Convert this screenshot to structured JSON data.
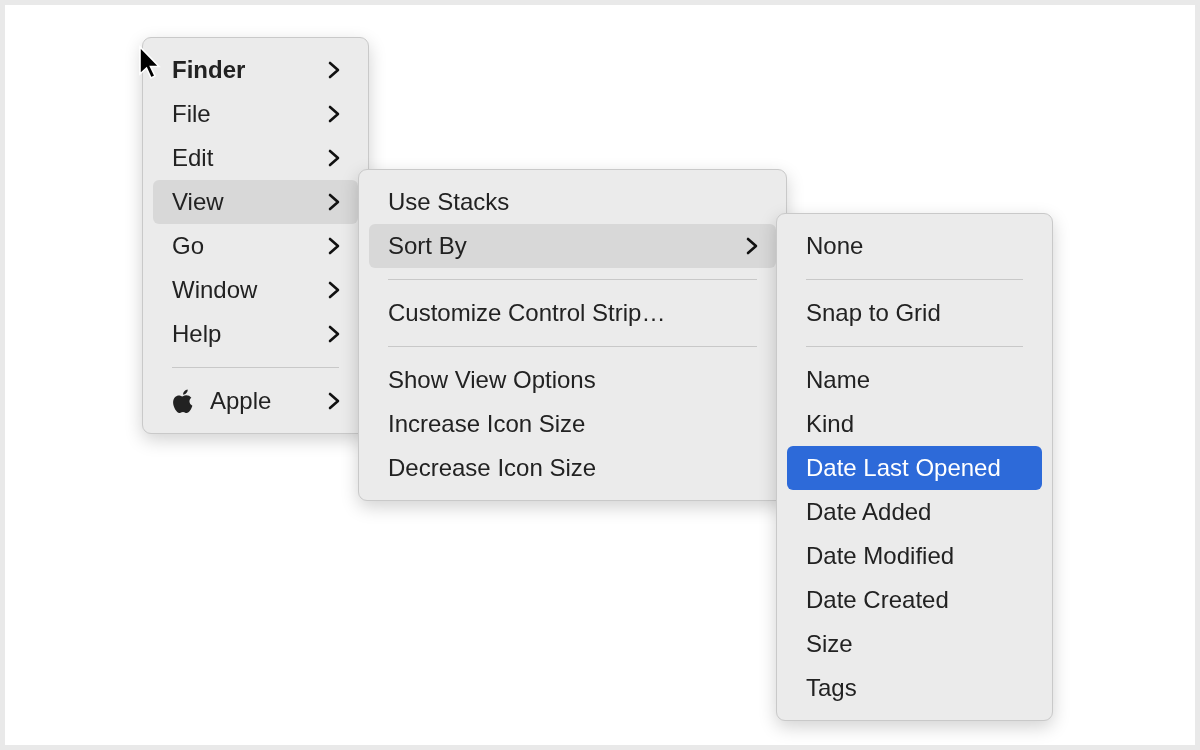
{
  "menus": [
    {
      "items": [
        {
          "kind": "app",
          "label": "Finder",
          "submenu": true,
          "expanded": false,
          "selected": false
        },
        {
          "kind": "item",
          "label": "File",
          "submenu": true,
          "expanded": false,
          "selected": false
        },
        {
          "kind": "item",
          "label": "Edit",
          "submenu": true,
          "expanded": false,
          "selected": false
        },
        {
          "kind": "item",
          "label": "View",
          "submenu": true,
          "expanded": true,
          "selected": false
        },
        {
          "kind": "item",
          "label": "Go",
          "submenu": true,
          "expanded": false,
          "selected": false
        },
        {
          "kind": "item",
          "label": "Window",
          "submenu": true,
          "expanded": false,
          "selected": false
        },
        {
          "kind": "item",
          "label": "Help",
          "submenu": true,
          "expanded": false,
          "selected": false
        },
        {
          "kind": "separator"
        },
        {
          "kind": "logo",
          "label": "Apple",
          "submenu": true,
          "expanded": false,
          "selected": false
        }
      ]
    },
    {
      "items": [
        {
          "kind": "item",
          "label": "Use Stacks",
          "submenu": false,
          "expanded": false,
          "selected": false
        },
        {
          "kind": "item",
          "label": "Sort By",
          "submenu": true,
          "expanded": true,
          "selected": false
        },
        {
          "kind": "separator"
        },
        {
          "kind": "item",
          "label": "Customize Control Strip…",
          "submenu": false,
          "expanded": false,
          "selected": false
        },
        {
          "kind": "separator"
        },
        {
          "kind": "item",
          "label": "Show View Options",
          "submenu": false,
          "expanded": false,
          "selected": false
        },
        {
          "kind": "item",
          "label": "Increase Icon Size",
          "submenu": false,
          "expanded": false,
          "selected": false
        },
        {
          "kind": "item",
          "label": "Decrease Icon Size",
          "submenu": false,
          "expanded": false,
          "selected": false
        }
      ]
    },
    {
      "items": [
        {
          "kind": "item",
          "label": "None",
          "submenu": false,
          "expanded": false,
          "selected": false
        },
        {
          "kind": "separator"
        },
        {
          "kind": "item",
          "label": "Snap to Grid",
          "submenu": false,
          "expanded": false,
          "selected": false
        },
        {
          "kind": "separator"
        },
        {
          "kind": "item",
          "label": "Name",
          "submenu": false,
          "expanded": false,
          "selected": false
        },
        {
          "kind": "item",
          "label": "Kind",
          "submenu": false,
          "expanded": false,
          "selected": false
        },
        {
          "kind": "item",
          "label": "Date Last Opened",
          "submenu": false,
          "expanded": false,
          "selected": true
        },
        {
          "kind": "item",
          "label": "Date Added",
          "submenu": false,
          "expanded": false,
          "selected": false
        },
        {
          "kind": "item",
          "label": "Date Modified",
          "submenu": false,
          "expanded": false,
          "selected": false
        },
        {
          "kind": "item",
          "label": "Date Created",
          "submenu": false,
          "expanded": false,
          "selected": false
        },
        {
          "kind": "item",
          "label": "Size",
          "submenu": false,
          "expanded": false,
          "selected": false
        },
        {
          "kind": "item",
          "label": "Tags",
          "submenu": false,
          "expanded": false,
          "selected": false
        }
      ]
    }
  ]
}
